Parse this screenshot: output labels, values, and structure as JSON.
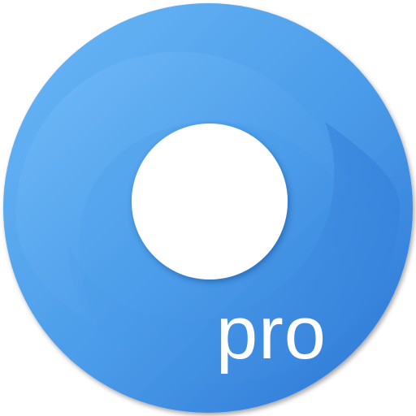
{
  "app_icon": {
    "badge_text": "pro",
    "colors": {
      "ring_light": "#62b1f6",
      "ring_mid": "#4a9be9",
      "ring_dark": "#2f7ad9",
      "hole": "#ffffff",
      "badge_text": "#ffffff"
    }
  }
}
